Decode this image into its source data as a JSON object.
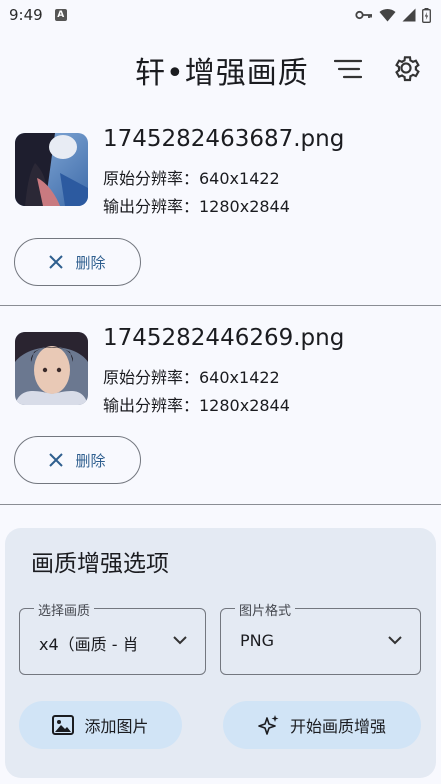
{
  "status_bar": {
    "time": "9:49",
    "notification_icon": "A"
  },
  "app_bar": {
    "title": "轩•增强画质"
  },
  "items": [
    {
      "filename": "1745282463687.png",
      "original_res": "原始分辨率：640x1422",
      "output_res": "输出分辨率：1280x2844",
      "delete_label": "删除"
    },
    {
      "filename": "1745282446269.png",
      "original_res": "原始分辨率：640x1422",
      "output_res": "输出分辨率：1280x2844",
      "delete_label": "删除"
    }
  ],
  "options": {
    "title": "画质增强选项",
    "quality": {
      "label": "选择画质",
      "value": "x4（画质 - 肖"
    },
    "format": {
      "label": "图片格式",
      "value": "PNG"
    },
    "add_image_label": "添加图片",
    "start_label": "开始画质增强"
  },
  "colors": {
    "accent": "#2f5f8f",
    "panel": "#e4eaf3",
    "button": "#d1e4f6"
  }
}
